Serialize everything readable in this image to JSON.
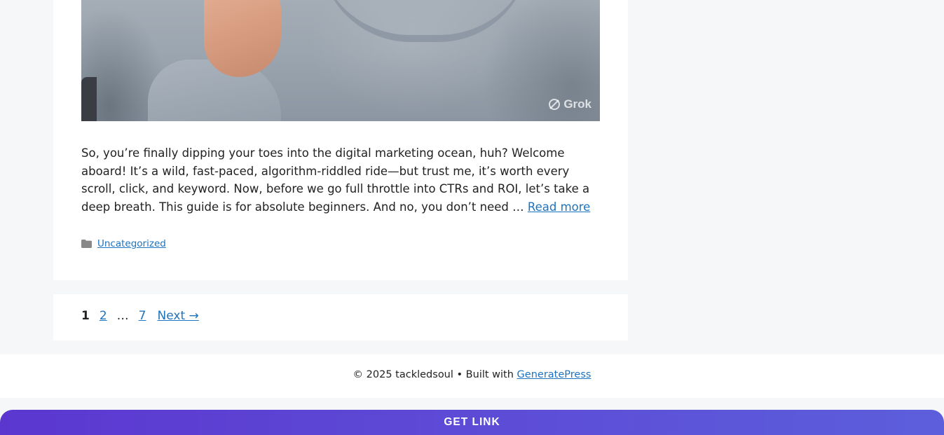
{
  "article": {
    "image_watermark": "Grok",
    "excerpt_text": "So, you’re finally dipping your toes into the digital marketing ocean, huh? Welcome aboard! It’s a wild, fast-paced, algorithm-riddled ride—but trust me, it’s worth every scroll, click, and keyword. Now, before we go full throttle into CTRs and ROI, let’s take a deep breath. This guide is for absolute beginners. And no, you don’t need … ",
    "read_more_label": "Read more",
    "category": "Uncategorized"
  },
  "pagination": {
    "current": "1",
    "page2": "2",
    "ellipsis": "…",
    "last": "7",
    "next_label": "Next →"
  },
  "footer": {
    "copyright_text": "© 2025 tackledsoul • Built with ",
    "theme_link": "GeneratePress"
  },
  "cta": {
    "label": "GET LINK"
  },
  "icons": {
    "category": "folder-icon",
    "watermark": "grok-logo-icon"
  },
  "colors": {
    "link": "#1e73be",
    "cta_gradient_start": "#5b37d0",
    "cta_gradient_end": "#5c5fdc"
  }
}
